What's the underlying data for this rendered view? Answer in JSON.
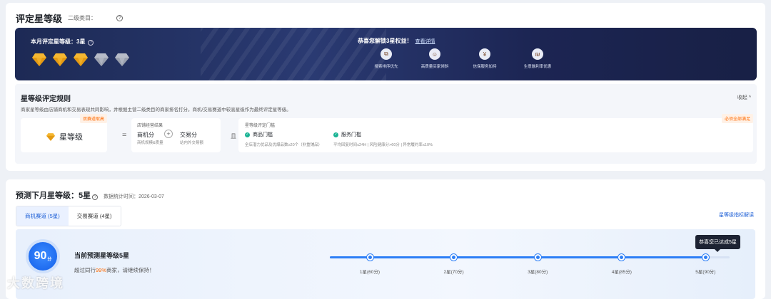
{
  "header": {
    "title": "评定星等级",
    "category_label": "二级类目："
  },
  "banner": {
    "level_label": "本月评定星等级：3星",
    "rating": {
      "filled": 3,
      "total": 5
    },
    "colors": {
      "gold": "#f5b731",
      "gray": "#b7bcc8",
      "bg": "#1d2a55"
    },
    "headline": "恭喜您解锁3星权益！",
    "detail_link": "查看详情",
    "benefits": [
      {
        "label": "搜索排序优先",
        "icon": "search-rank-icon"
      },
      {
        "label": "高质量买家倾斜",
        "icon": "buyer-icon"
      },
      {
        "label": "信保服务加持",
        "icon": "shield-icon"
      },
      {
        "label": "生意融利率优惠",
        "icon": "finance-icon"
      }
    ]
  },
  "rules": {
    "title": "星等级评定规则",
    "collapse": "收起 ^",
    "description": "商家星等级由店铺商机和交易表现共同影响，并根据主营二级类目的商家排名打分。商机/交易赛道中较高星级作为最终评定星等级。",
    "star_box": {
      "tag": "双赛道取高",
      "name": "星等级"
    },
    "equals": "=",
    "shop": {
      "title": "店铺经营结果",
      "a": "商机分",
      "a_sub": "商机规模&质量",
      "plus": "+",
      "b": "交易分",
      "b_sub": "站内外交易额"
    },
    "and": "且",
    "gate": {
      "tag": "必须全部满足",
      "title": "星等级评定门槛",
      "goods_title": "商品门槛",
      "goods_desc": "全店潜力优品及优爆品数≥20个（非重铺品）",
      "service_title": "服务门槛",
      "service_desc": "平均回复时间≤24H | 风险健康分>60分 | 异常履约率≤10%"
    }
  },
  "prediction": {
    "title": "预测下月星等级：5星",
    "stat_date": "数据统计时间：2026-03-07",
    "tabs": [
      "商机赛道 (5星)",
      "交易赛道 (4星)"
    ],
    "active_tab": 0,
    "interp_link": "星等级指标解读",
    "score": "90",
    "score_unit": "分",
    "current_title": "当前预测星等级5星",
    "desc_prefix": "超过同行",
    "desc_pct": "99%",
    "desc_suffix": "商家，请继续保持！",
    "progress_fraction": 0.94,
    "milestones": [
      {
        "label": "1星(60分)",
        "pos": 0.1
      },
      {
        "label": "2星(70分)",
        "pos": 0.31
      },
      {
        "label": "3星(80分)",
        "pos": 0.52
      },
      {
        "label": "4星(85分)",
        "pos": 0.73
      },
      {
        "label": "5星(90分)",
        "pos": 0.94
      }
    ],
    "tooltip": "恭喜您已达成5星"
  },
  "watermark": "大数跨境"
}
